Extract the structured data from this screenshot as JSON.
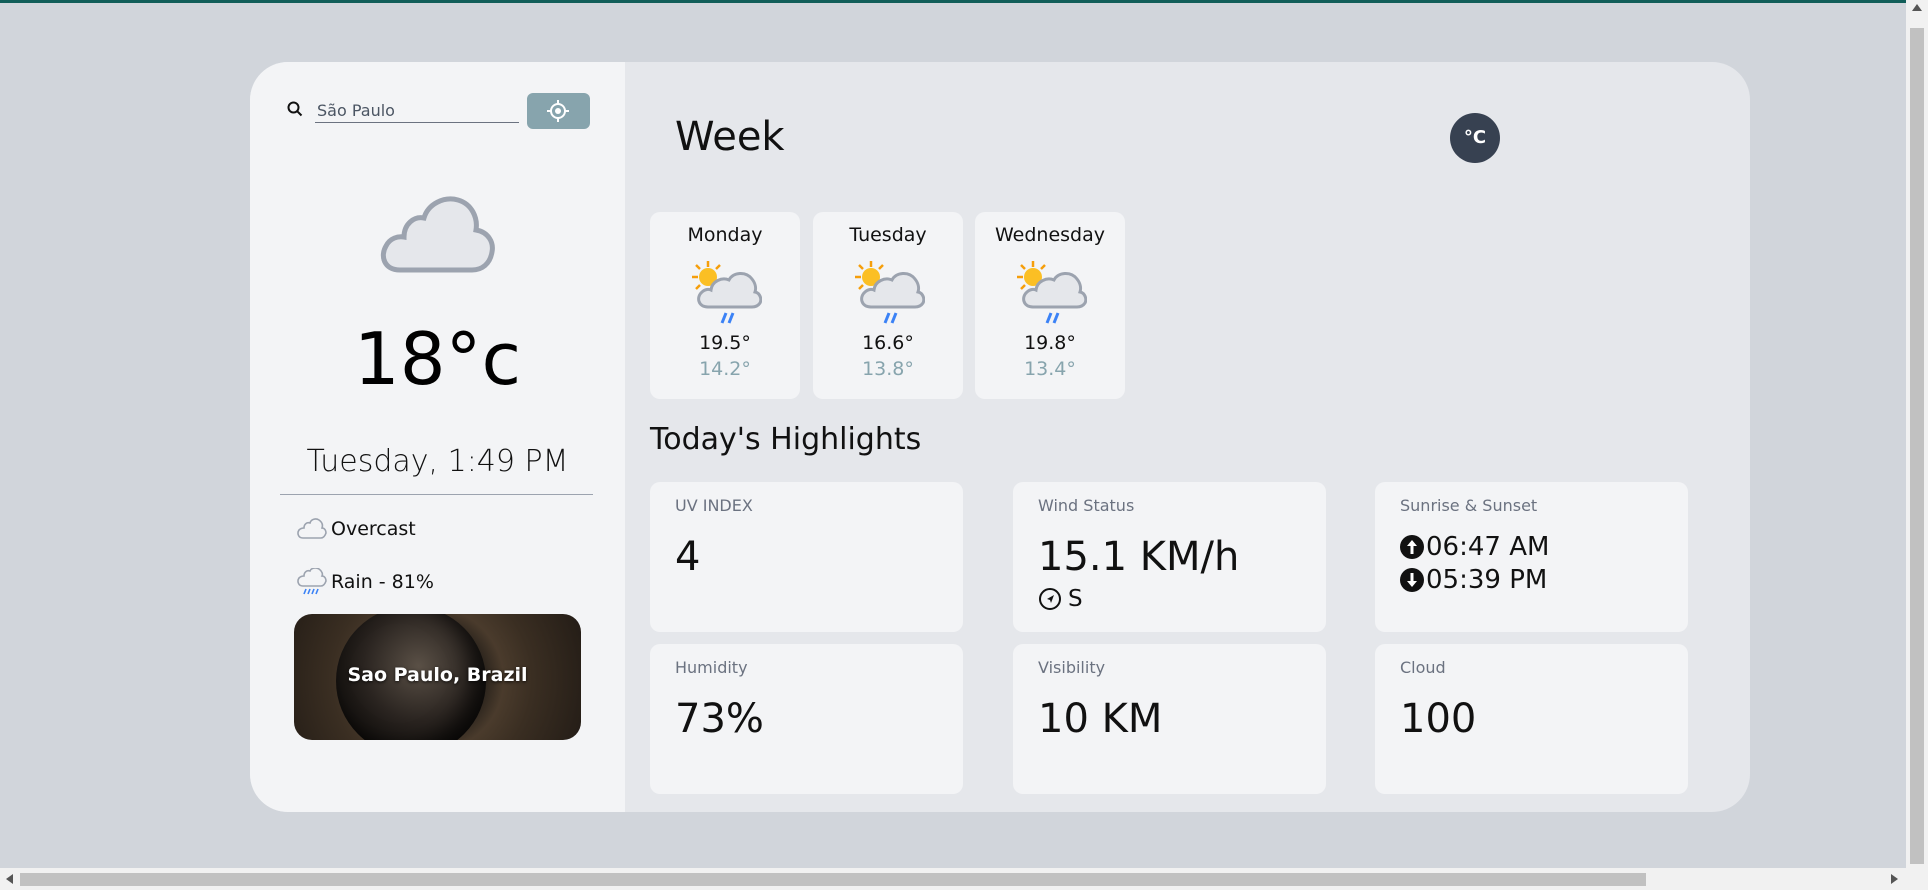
{
  "colors": {
    "page_bg": "#d1d5db",
    "sidebar_bg": "#f3f4f6",
    "main_bg": "#e5e7eb",
    "accent": "#87a4ad",
    "unit_button": "#374151",
    "low_temp": "#87a4ad"
  },
  "search": {
    "value": "São Paulo",
    "placeholder": "Search"
  },
  "current": {
    "icon": "overcast-cloud-icon",
    "temperature": "18°c",
    "datetime": "Tuesday, 1:49 PM",
    "condition": "Overcast",
    "rain": "Rain - 81%",
    "city": "Sao Paulo, Brazil"
  },
  "header": {
    "title": "Week",
    "unit": "°C"
  },
  "forecast": [
    {
      "day": "Monday",
      "high": "19.5°",
      "low": "14.2°",
      "icon": "sun-cloud-rain-icon"
    },
    {
      "day": "Tuesday",
      "high": "16.6°",
      "low": "13.8°",
      "icon": "sun-cloud-rain-icon"
    },
    {
      "day": "Wednesday",
      "high": "19.8°",
      "low": "13.4°",
      "icon": "sun-cloud-rain-icon"
    }
  ],
  "highlights": {
    "title": "Today's Highlights",
    "uv": {
      "label": "UV INDEX",
      "value": "4"
    },
    "wind": {
      "label": "Wind Status",
      "value": "15.1 KM/h",
      "direction": "S"
    },
    "sun": {
      "label": "Sunrise & Sunset",
      "sunrise": "06:47 AM",
      "sunset": "05:39 PM"
    },
    "humidity": {
      "label": "Humidity",
      "value": "73%"
    },
    "visibility": {
      "label": "Visibility",
      "value": "10 KM"
    },
    "cloud": {
      "label": "Cloud",
      "value": "100"
    }
  }
}
